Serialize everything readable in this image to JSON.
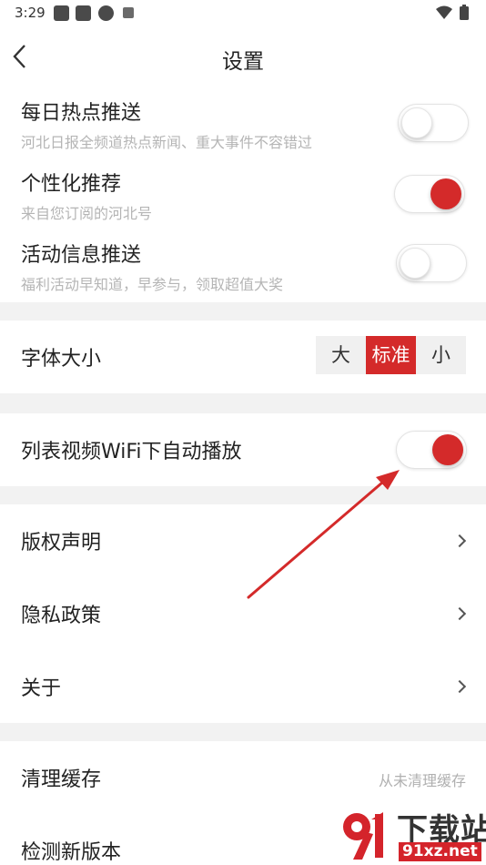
{
  "status_bar": {
    "time": "3:29",
    "icons": [
      "notification-icon",
      "notification-icon",
      "vpn-icon",
      "app-icon"
    ],
    "right_icons": [
      "wifi-icon",
      "battery-icon"
    ]
  },
  "nav": {
    "title": "设置",
    "back_icon": "chevron-left-icon"
  },
  "push_settings": [
    {
      "title": "每日热点推送",
      "subtitle": "河北日报全频道热点新闻、重大事件不容错过",
      "enabled": false
    },
    {
      "title": "个性化推荐",
      "subtitle": "来自您订阅的河北号",
      "enabled": true
    },
    {
      "title": "活动信息推送",
      "subtitle": "福利活动早知道，早参与，领取超值大奖",
      "enabled": false
    }
  ],
  "font_size": {
    "title": "字体大小",
    "options": [
      "大",
      "标准",
      "小"
    ],
    "selected": "标准"
  },
  "video_autoplay": {
    "title": "列表视频WiFi下自动播放",
    "enabled": true
  },
  "links": [
    {
      "title": "版权声明"
    },
    {
      "title": "隐私政策"
    },
    {
      "title": "关于"
    }
  ],
  "cache": {
    "title": "清理缓存",
    "status": "从未清理缓存"
  },
  "update": {
    "title": "检测新版本"
  },
  "annotation": {
    "arrow_color": "#d42a2a"
  },
  "watermark": {
    "main": "下载站",
    "sub": "91xz.net"
  },
  "colors": {
    "accent": "#d42a2a",
    "divider_gap": "#f2f2f2",
    "subtitle": "#b5b5b5"
  }
}
